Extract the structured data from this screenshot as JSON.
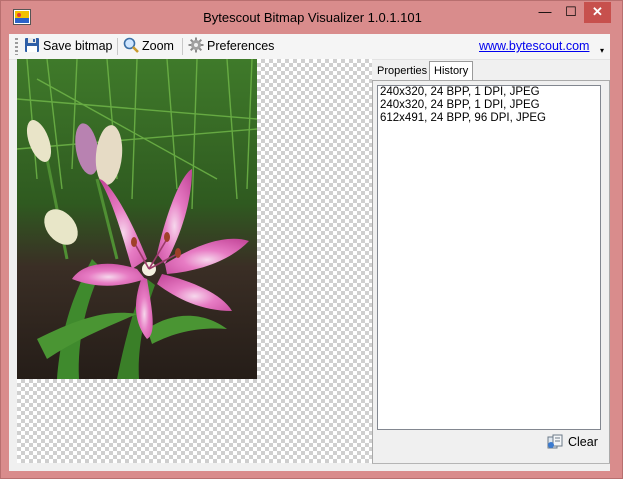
{
  "window": {
    "title": "Bytescout Bitmap Visualizer 1.0.1.101"
  },
  "caption_buttons": {
    "minimize": "—",
    "maximize": "☐",
    "close": "✕"
  },
  "toolbar": {
    "save_label": "Save bitmap",
    "zoom_label": "Zoom",
    "preferences_label": "Preferences",
    "website_link": "www.bytescout.com",
    "overflow_glyph": "▾"
  },
  "icons": {
    "app": "bitmap-app-icon",
    "save": "floppy-disk-icon",
    "zoom": "magnifier-icon",
    "preferences": "gear-icon",
    "clear": "clear-icon"
  },
  "tabs": [
    {
      "label": "Properties",
      "selected": false
    },
    {
      "label": "History",
      "selected": true
    }
  ],
  "history": {
    "items": [
      "240x320, 24 BPP, 1 DPI, JPEG",
      "240x320, 24 BPP, 1 DPI, JPEG",
      "612x491, 24 BPP, 96 DPI, JPEG"
    ],
    "clear_label": "Clear"
  },
  "colors": {
    "frame": "#d98c8c",
    "close_button": "#c7504d",
    "link": "#0000ee"
  }
}
